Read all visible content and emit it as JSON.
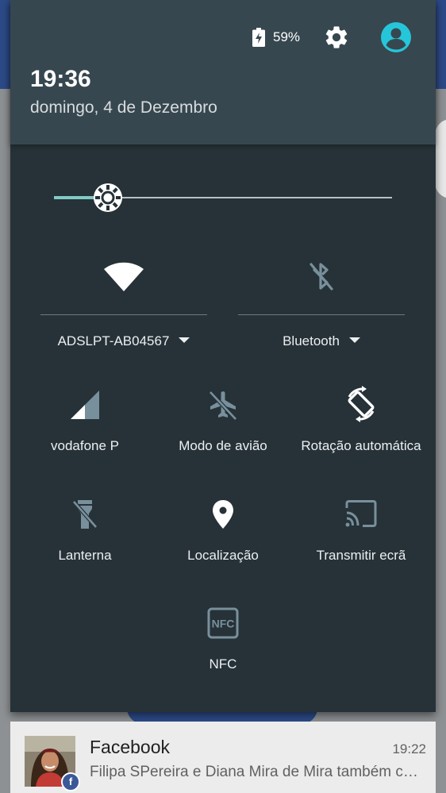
{
  "status": {
    "battery_text": "59%",
    "battery_icon": "battery-charging-icon",
    "settings_icon": "gear-icon",
    "user_icon": "account-circle-icon",
    "accent": "#26c6da"
  },
  "header": {
    "time": "19:36",
    "date": "domingo, 4 de Dezembro"
  },
  "brightness": {
    "level_fraction": 0.16,
    "accent": "#80cbc4"
  },
  "wifi": {
    "label": "ADSLPT-AB04567",
    "icon": "wifi-full-icon",
    "enabled": true
  },
  "bluetooth": {
    "label": "Bluetooth",
    "icon": "bluetooth-disabled-icon",
    "enabled": false
  },
  "tiles": [
    {
      "label": "vodafone P",
      "icon": "cell-signal-icon",
      "enabled": true
    },
    {
      "label": "Modo de avião",
      "icon": "airplane-mode-off-icon",
      "enabled": false
    },
    {
      "label": "Rotação automática",
      "icon": "auto-rotate-icon",
      "enabled": true
    },
    {
      "label": "Lanterna",
      "icon": "flashlight-off-icon",
      "enabled": false
    },
    {
      "label": "Localização",
      "icon": "location-pin-icon",
      "enabled": true
    },
    {
      "label": "Transmitir ecrã",
      "icon": "cast-icon",
      "enabled": false
    },
    {
      "label": "NFC",
      "icon": "nfc-icon",
      "enabled": false
    }
  ],
  "notification": {
    "app": "Facebook",
    "time": "19:22",
    "text": "Filipa SPereira e Diana Mira de Mira também comentaram",
    "badge": "f"
  }
}
